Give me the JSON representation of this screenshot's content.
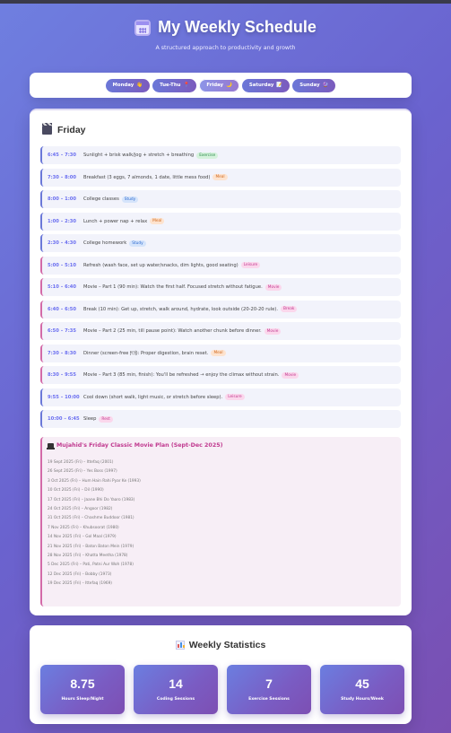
{
  "header": {
    "title": "My Weekly Schedule",
    "subtitle": "A structured approach to productivity and growth"
  },
  "tabs": [
    {
      "label": "Monday",
      "emoji": "👋",
      "active": false
    },
    {
      "label": "Tue-Thu",
      "emoji": "📍",
      "active": false
    },
    {
      "label": "Friday",
      "emoji": "🌙",
      "active": true
    },
    {
      "label": "Saturday",
      "emoji": "📝",
      "active": false
    },
    {
      "label": "Sunday",
      "emoji": "🔮",
      "active": false
    }
  ],
  "day": {
    "title": "Friday",
    "entries": [
      {
        "time": "6:45 – 7:30",
        "activity": "Sunlight + brisk walk/jog + stretch + breathing",
        "tag": "Exercise",
        "kind": "normal"
      },
      {
        "time": "7:30 – 8:00",
        "activity": "Breakfast (3 eggs, 7 almonds, 1 date, little mess food)",
        "tag": "Meal",
        "kind": "normal"
      },
      {
        "time": "8:00 – 1:00",
        "activity": "College classes",
        "tag": "Study",
        "kind": "normal"
      },
      {
        "time": "1:00 – 2:30",
        "activity": "Lunch + power nap + relax",
        "tag": "Meal",
        "kind": "normal"
      },
      {
        "time": "2:30 – 4:30",
        "activity": "College homework",
        "tag": "Study",
        "kind": "normal"
      },
      {
        "time": "5:00 – 5:10",
        "activity": "Refresh (wash face, set up water/snacks, dim lights, good seating)",
        "tag": "Leisure",
        "kind": "leisure"
      },
      {
        "time": "5:10 – 6:40",
        "activity": "Movie – Part 1 (90 min): Watch the first half. Focused stretch without fatigue.",
        "tag": "Movie",
        "kind": "leisure"
      },
      {
        "time": "6:40 – 6:50",
        "activity": "Break (10 min): Get up, stretch, walk around, hydrate, look outside (20-20-20 rule).",
        "tag": "Break",
        "kind": "leisure"
      },
      {
        "time": "6:50 – 7:35",
        "activity": "Movie – Part 2 (25 min, till pause point): Watch another chunk before dinner.",
        "tag": "Movie",
        "kind": "leisure"
      },
      {
        "time": "7:30 – 8:30",
        "activity": "Dinner (screen-free 🍽): Proper digestion, brain reset.",
        "tag": "Meal",
        "kind": "leisure"
      },
      {
        "time": "8:30 – 9:55",
        "activity": "Movie – Part 3 (85 min, finish): You'll be refreshed → enjoy the climax without strain.",
        "tag": "Movie",
        "kind": "leisure"
      },
      {
        "time": "9:55 – 10:00",
        "activity": "Cool down (short walk, light music, or stretch before sleep).",
        "tag": "Leisure",
        "kind": "normal"
      },
      {
        "time": "10:00 – 6:45",
        "activity": "Sleep",
        "tag": "Rest",
        "kind": "normal"
      }
    ],
    "movie_plan": {
      "title": "Mujahid's Friday Classic Movie Plan (Sept-Dec 2025)",
      "items": [
        "19 Sept 2025 (Fri) – Ittefaq (2001)",
        "26 Sept 2025 (Fri) – Yes Boss (1997)",
        "3 Oct 2025 (Fri) – Hum Hain Rahi Pyar Ke (1993)",
        "10 Oct 2025 (Fri) – Dil (1990)",
        "17 Oct 2025 (Fri) – Jaane Bhi Do Yaaro (1983)",
        "24 Oct 2025 (Fri) – Angoor (1982)",
        "31 Oct 2025 (Fri) – Chashme Buddoor (1981)",
        "7 Nov 2025 (Fri) – Khubsoorat (1980)",
        "14 Nov 2025 (Fri) – Gol Maal (1979)",
        "21 Nov 2025 (Fri) – Baton Baton Mein (1979)",
        "28 Nov 2025 (Fri) – Khatta Meetha (1978)",
        "5 Dec 2025 (Fri) – Pati, Patni Aur Woh (1978)",
        "12 Dec 2025 (Fri) – Bobby (1973)",
        "19 Dec 2025 (Fri) – Ittefaq (1969)"
      ]
    }
  },
  "stats": {
    "title": "Weekly Statistics",
    "items": [
      {
        "value": "8.75",
        "label": "Hours Sleep/Night"
      },
      {
        "value": "14",
        "label": "Coding Sessions"
      },
      {
        "value": "7",
        "label": "Exercise Sessions"
      },
      {
        "value": "45",
        "label": "Study Hours/Week"
      }
    ]
  }
}
